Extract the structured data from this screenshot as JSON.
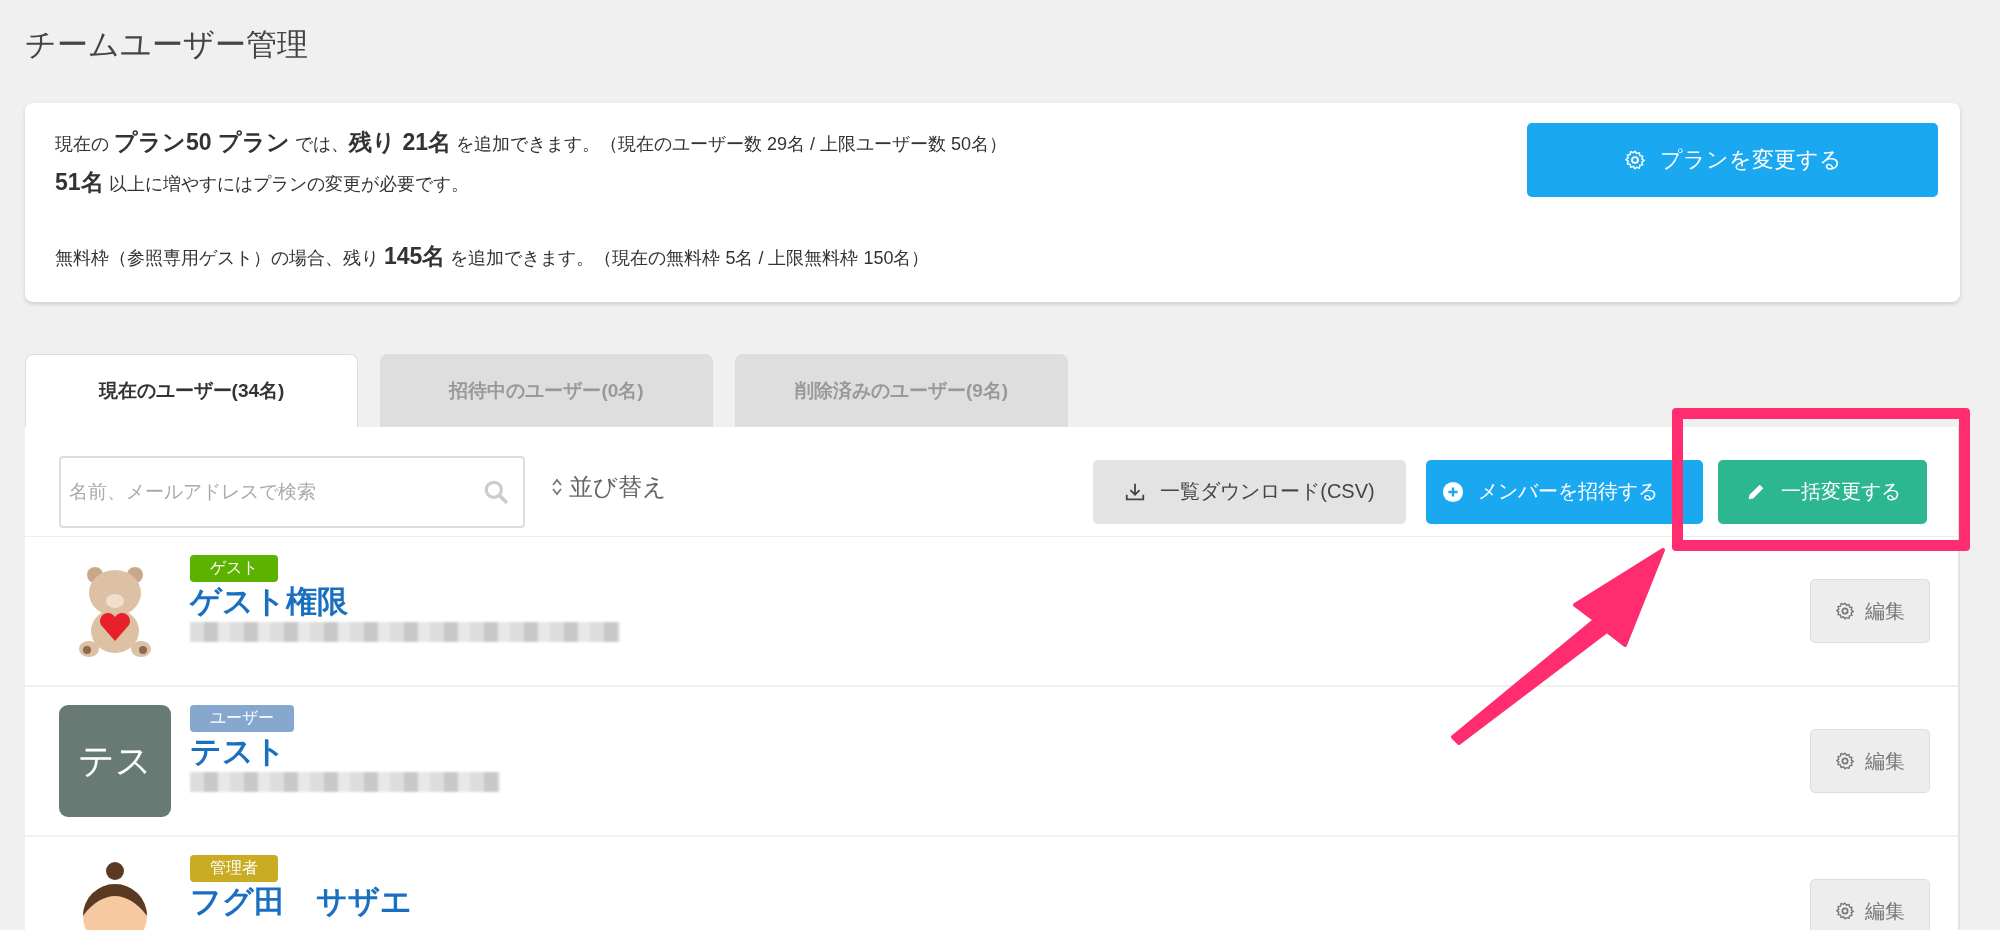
{
  "page_title": "チームユーザー管理",
  "plan_info": {
    "lines": [
      "現在の **プラン50 プラン** では、**残り 21名** を追加できます。（現在のユーザー数 29名 / 上限ユーザー数 50名）",
      "**51名** 以上に増やすにはプランの変更が必要です。",
      "無料枠（参照専用ゲスト）の場合、残り **145名** を追加できます。（現在の無料枠 5名 / 上限無料枠 150名）"
    ],
    "button": "プランを変更する"
  },
  "tabs": [
    {
      "label": "現在のユーザー(34名)",
      "selected": true
    },
    {
      "label": "招待中のユーザー(0名)",
      "selected": false
    },
    {
      "label": "削除済みのユーザー(9名)",
      "selected": false
    }
  ],
  "search": {
    "placeholder": "名前、メールアドレスで検索"
  },
  "sort": "並び替え",
  "toolbar_buttons": [
    {
      "kind": "download",
      "label": "一覧ダウンロード(CSV)"
    },
    {
      "kind": "invite",
      "label": "メンバーを招待する"
    },
    {
      "kind": "bulk",
      "label": "一括変更する"
    }
  ],
  "users": [
    {
      "avatar": {
        "kind": "bear"
      },
      "role": "ゲスト",
      "color": "#5bb300",
      "name": "ゲスト権限",
      "edit": "編集"
    },
    {
      "avatar": {
        "kind": "initials",
        "text": "テス"
      },
      "role": "ユーザー",
      "color": "#86a8cf",
      "name": "テスト",
      "edit": "編集"
    },
    {
      "avatar": {
        "kind": "person"
      },
      "role": "管理者",
      "color": "#c9ac22",
      "name": "フグ田　サザエ",
      "edit": "編集"
    }
  ],
  "annotation": {
    "highlight": true,
    "arrow": true
  }
}
